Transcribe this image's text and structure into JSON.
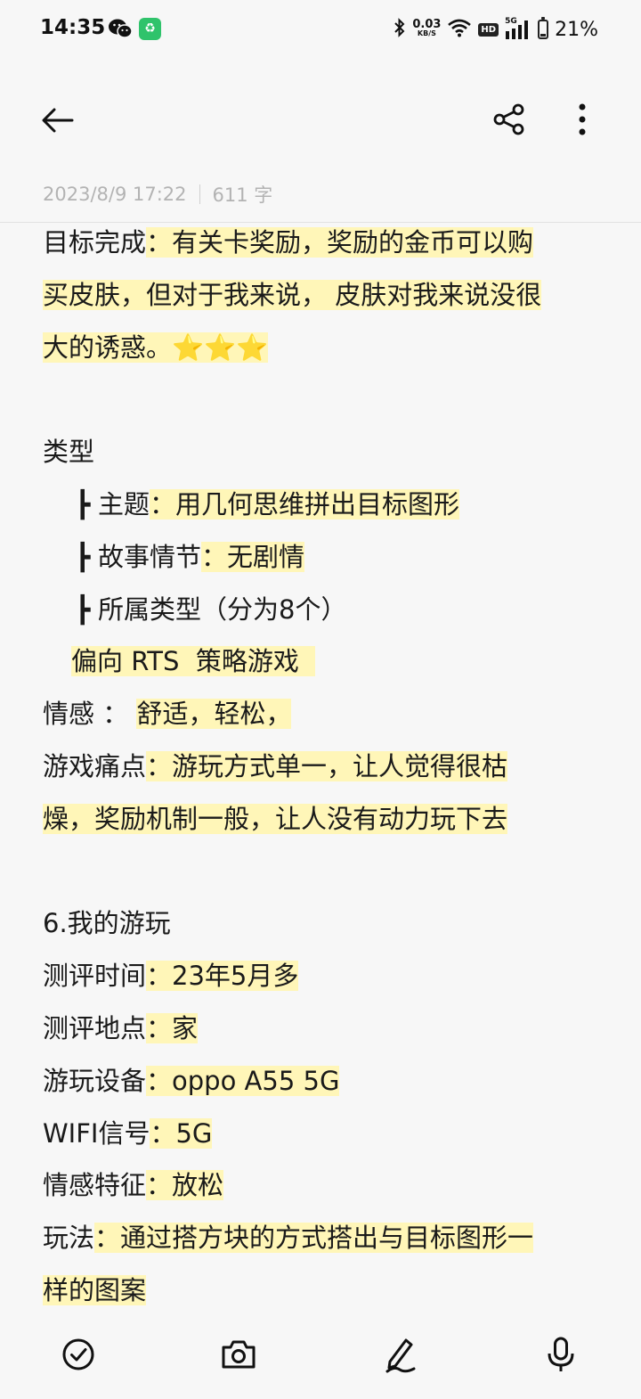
{
  "status_bar": {
    "time": "14:35",
    "speed_value": "0.03",
    "speed_unit": "KB/S",
    "hd": "HD",
    "network": "5G",
    "battery_percent": "21%",
    "battery_level": 0.21
  },
  "app_bar": {
    "icons": [
      "back-arrow-icon",
      "share-icon",
      "more-vertical-icon"
    ]
  },
  "note_meta": {
    "date": "2023/8/9 17:22",
    "word_count": "611 字"
  },
  "note": {
    "l1_label": "目标完成",
    "l1_text": "：有关卡奖励，奖励的金币可以购",
    "l2_text": "买皮肤，但对于我来说， 皮肤对我来说没很",
    "l3_text": "大的诱惑。⭐⭐⭐",
    "type_heading": "类型",
    "branch_char": "┣",
    "theme_label": "主题",
    "theme_text": "：用几何思维拼出目标图形",
    "story_label": "故事情节",
    "story_text": "：无剧情",
    "genre_label": "所属类型（分为8个）",
    "genre_text": "偏向 RTS  策略游戏  ",
    "emotion_label": "情感 ：",
    "emotion_text": "舒适，轻松，",
    "pain_label": "游戏痛点",
    "pain_text1": "：游玩方式单一，让人觉得很枯",
    "pain_text2": "燥，奖励机制一般，让人没有动力玩下去",
    "section_heading": "6.我的游玩",
    "eval_time_label": "测评时间",
    "eval_time_value": "：23年5月多",
    "eval_place_label": "测评地点",
    "eval_place_value": "：家",
    "device_label": "游玩设备",
    "device_value": "：oppo A55 5G",
    "wifi_label": "WIFI信号",
    "wifi_value": "：5G",
    "feeling_label": "情感特征",
    "feeling_value": "：放松",
    "gameplay_label": "玩法",
    "gameplay_text1": "：通过搭方块的方式搭出与目标图形一",
    "gameplay_text2": "样的图案"
  },
  "bottom_toolbar": {
    "icons": [
      "checklist-icon",
      "camera-icon",
      "handwriting-pen-icon",
      "microphone-icon"
    ]
  },
  "colors": {
    "highlight": "#fff6b8",
    "background": "#f7f7f7",
    "meta_text": "#b3b3b3"
  }
}
